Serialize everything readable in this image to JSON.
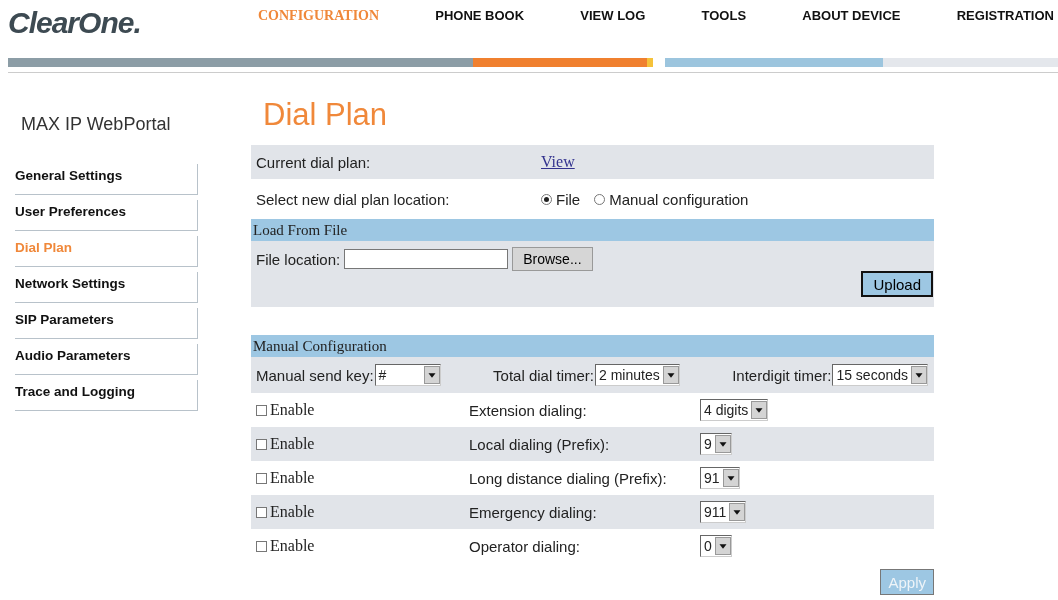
{
  "logo": "ClearOne.",
  "nav": [
    {
      "label": "CONFIGURATION",
      "selected": true
    },
    {
      "label": "PHONE BOOK",
      "selected": false
    },
    {
      "label": "VIEW LOG",
      "selected": false
    },
    {
      "label": "TOOLS",
      "selected": false
    },
    {
      "label": "ABOUT DEVICE",
      "selected": false
    },
    {
      "label": "REGISTRATION",
      "selected": false
    }
  ],
  "sidebar": {
    "title": "MAX IP WebPortal",
    "items": [
      {
        "label": "General Settings",
        "selected": false
      },
      {
        "label": "User Preferences",
        "selected": false
      },
      {
        "label": "Dial Plan",
        "selected": true
      },
      {
        "label": "Network Settings",
        "selected": false
      },
      {
        "label": "SIP Parameters",
        "selected": false
      },
      {
        "label": "Audio Parameters",
        "selected": false
      },
      {
        "label": "Trace and Logging",
        "selected": false
      }
    ]
  },
  "page_title": "Dial Plan",
  "current_plan": {
    "label": "Current dial plan:",
    "link": "View"
  },
  "location": {
    "label": "Select new dial plan location:",
    "options": [
      {
        "label": "File",
        "selected": true
      },
      {
        "label": "Manual configuration",
        "selected": false
      }
    ]
  },
  "load_from_file": {
    "heading": "Load From File",
    "file_label": "File location:",
    "browse_button": "Browse...",
    "upload_button": "Upload"
  },
  "manual": {
    "heading": "Manual Configuration",
    "timers": [
      {
        "label": "Manual send key:",
        "value": "#"
      },
      {
        "label": "Total dial timer:",
        "value": "2 minutes"
      },
      {
        "label": "Interdigit timer:",
        "value": "15 seconds"
      }
    ],
    "rules": [
      {
        "enable_label": "Enable",
        "checked": false,
        "label": "Extension dialing:",
        "value": "4 digits"
      },
      {
        "enable_label": "Enable",
        "checked": false,
        "label": "Local dialing (Prefix):",
        "value": "9"
      },
      {
        "enable_label": "Enable",
        "checked": false,
        "label": "Long distance dialing (Prefix):",
        "value": "91"
      },
      {
        "enable_label": "Enable",
        "checked": false,
        "label": "Emergency dialing:",
        "value": "911"
      },
      {
        "enable_label": "Enable",
        "checked": false,
        "label": "Operator dialing:",
        "value": "0"
      }
    ],
    "apply_button": {
      "label": "Apply",
      "disabled": true
    }
  }
}
